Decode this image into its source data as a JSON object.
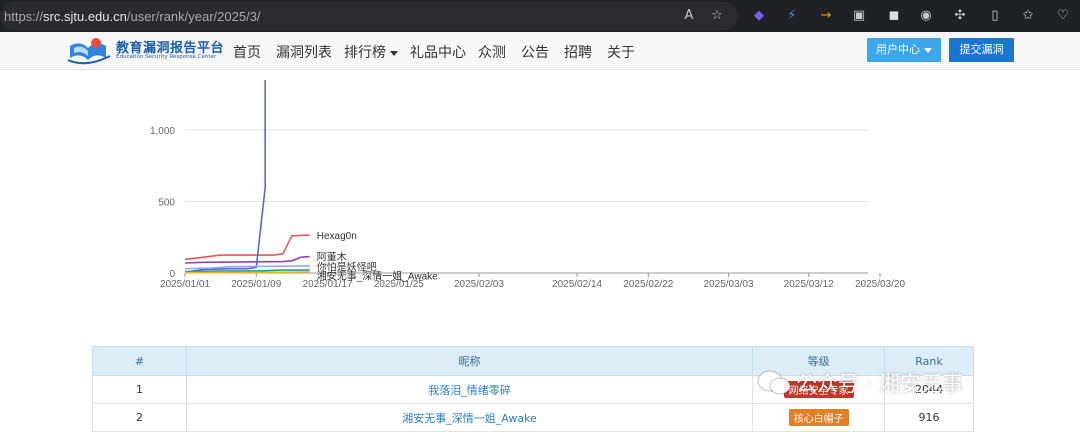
{
  "browser": {
    "url_prefix": "https://",
    "url_host": "src.sjtu.edu.cn",
    "url_path": "/user/rank/year/2025/3/"
  },
  "nav": {
    "logo_title": "教育漏洞报告平台",
    "logo_subtitle": "Education Security Response Center",
    "items": [
      {
        "label": "首页"
      },
      {
        "label": "漏洞列表"
      },
      {
        "label": "排行榜"
      },
      {
        "label": "礼品中心"
      },
      {
        "label": "众测"
      },
      {
        "label": "公告"
      },
      {
        "label": "招聘"
      },
      {
        "label": "关于"
      }
    ],
    "user_center": "用户中心",
    "submit_vuln": "提交漏洞"
  },
  "chart_data": {
    "type": "line",
    "x_ticks": [
      "2025/01/01",
      "2025/01/09",
      "2025/01/17",
      "2025/01/25",
      "2025/02/03",
      "2025/02/14",
      "2025/02/22",
      "2025/03/03",
      "2025/03/12",
      "2025/03/20"
    ],
    "y_ticks": [
      "0",
      "500",
      "1,000"
    ],
    "ylim": [
      0,
      1400
    ],
    "grid": true,
    "series": [
      {
        "name": "Hexag0n",
        "color": "#e05a5a",
        "points": [
          [
            "2025/01/01",
            95
          ],
          [
            "2025/01/03",
            110
          ],
          [
            "2025/01/05",
            125
          ],
          [
            "2025/01/11",
            125
          ],
          [
            "2025/01/12",
            135
          ],
          [
            "2025/01/13",
            260
          ],
          [
            "2025/01/15",
            265
          ]
        ]
      },
      {
        "name": "阿董木",
        "color": "#8e44ad",
        "points": [
          [
            "2025/01/01",
            70
          ],
          [
            "2025/01/03",
            75
          ],
          [
            "2025/01/12",
            80
          ],
          [
            "2025/01/13",
            85
          ],
          [
            "2025/01/14",
            110
          ],
          [
            "2025/01/15",
            115
          ]
        ]
      },
      {
        "name": "你怕是妖怪吧",
        "color": "#4a6fd0",
        "points": [
          [
            "2025/01/01",
            5
          ],
          [
            "2025/01/03",
            25
          ],
          [
            "2025/01/06",
            30
          ],
          [
            "2025/01/08",
            30
          ],
          [
            "2025/01/09",
            40
          ],
          [
            "2025/01/10",
            600
          ],
          [
            "2025/01/10",
            1350
          ]
        ]
      },
      {
        "name": "湘安无事_深情一姐_Awake",
        "color": "#2a9d8f",
        "points": [
          [
            "2025/01/01",
            10
          ],
          [
            "2025/01/05",
            15
          ],
          [
            "2025/01/09",
            15
          ],
          [
            "2025/01/12",
            20
          ],
          [
            "2025/01/15",
            20
          ]
        ]
      },
      {
        "name": "",
        "color": "#9aa5ff",
        "points": [
          [
            "2025/01/01",
            30
          ],
          [
            "2025/01/04",
            35
          ],
          [
            "2025/01/06",
            45
          ],
          [
            "2025/01/15",
            50
          ]
        ]
      },
      {
        "name": "",
        "color": "#f0b429",
        "points": [
          [
            "2025/01/01",
            2
          ],
          [
            "2025/01/10",
            5
          ],
          [
            "2025/01/15",
            8
          ]
        ]
      }
    ]
  },
  "table": {
    "headers": [
      "#",
      "昵称",
      "等级",
      "Rank"
    ],
    "rows": [
      {
        "rank_no": "1",
        "nickname": "我落泪_情绪零碎",
        "level": "网络安全专家",
        "level_color": "#c0392b",
        "rank": "2044"
      },
      {
        "rank_no": "2",
        "nickname": "湘安无事_深情一姐_Awake",
        "level": "核心白帽子",
        "level_color": "#e67e22",
        "rank": "916"
      }
    ]
  },
  "watermark": {
    "text": "公众号 · 湘安无事"
  }
}
